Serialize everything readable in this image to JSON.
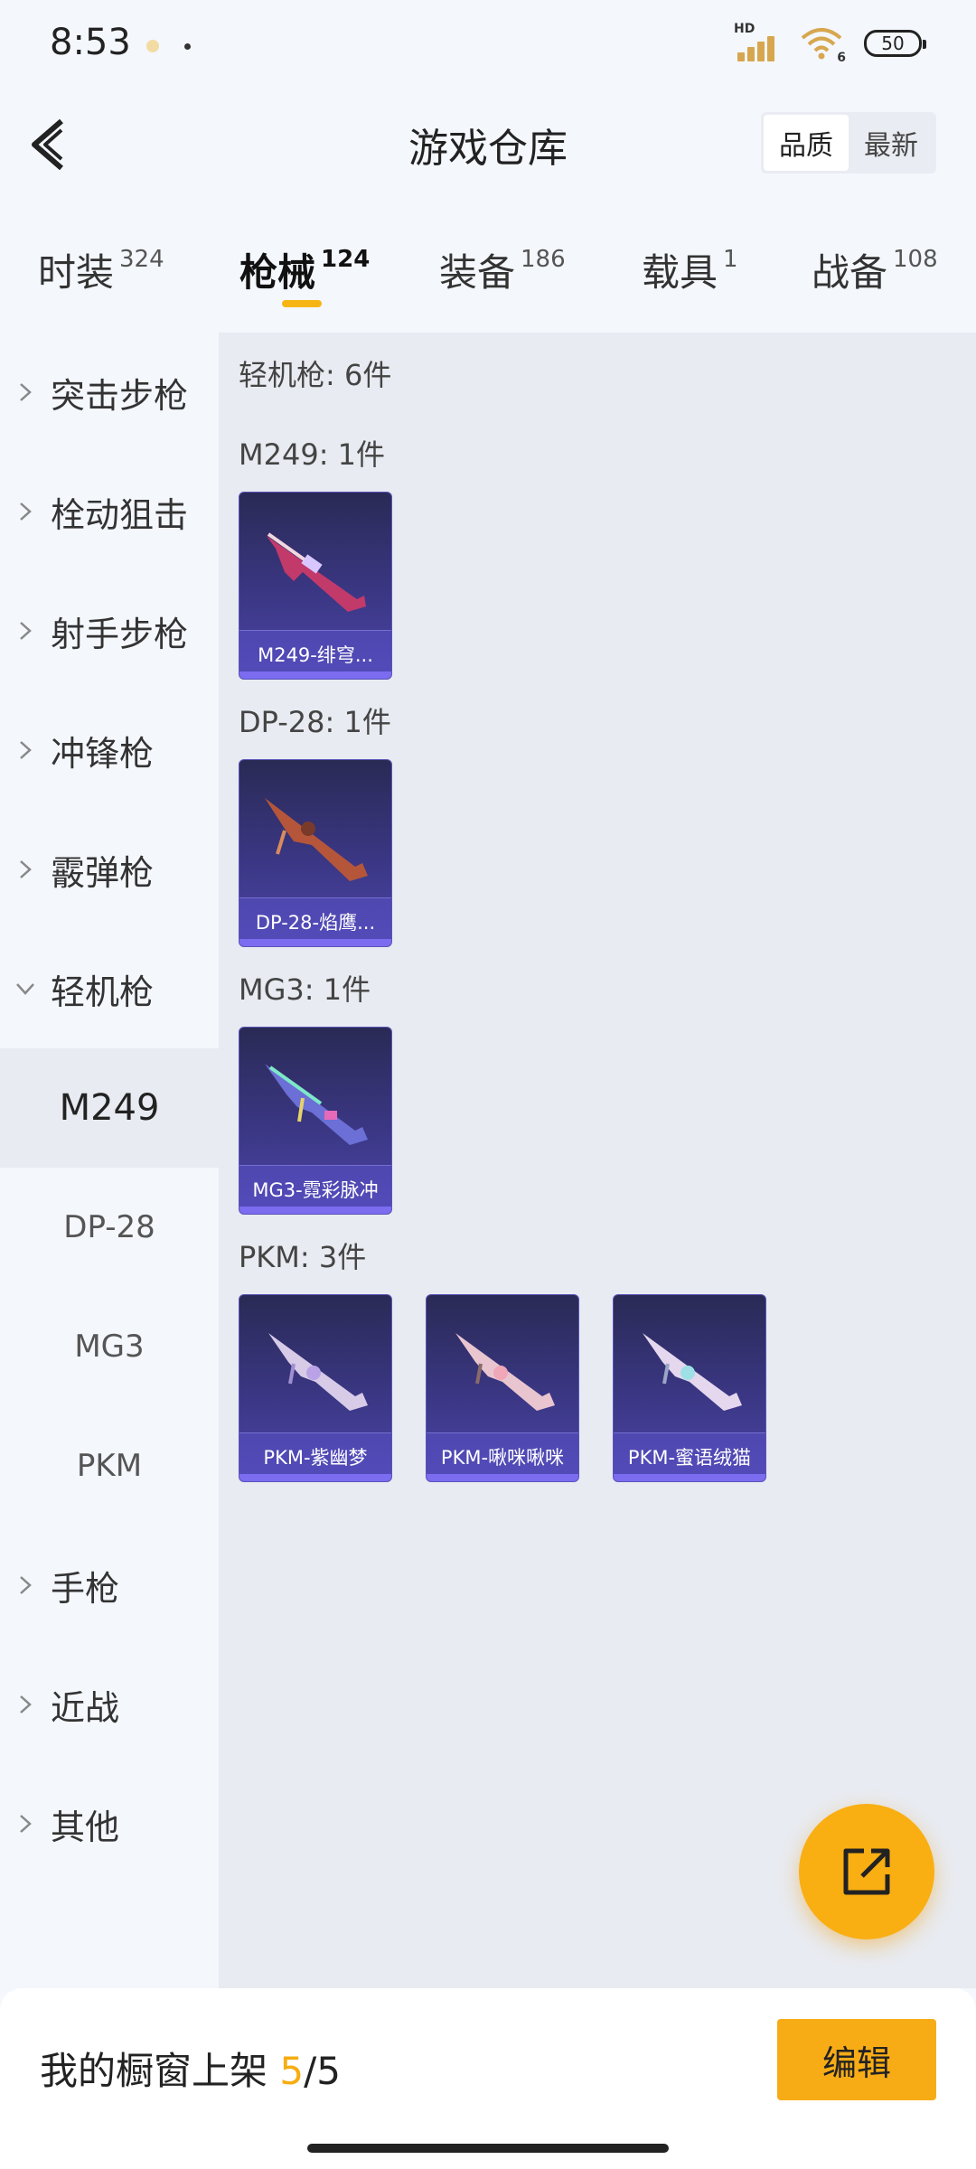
{
  "status_bar": {
    "time": "8:53",
    "battery": "50",
    "network_badge": "HD",
    "wifi_badge": "6"
  },
  "header": {
    "title": "游戏仓库",
    "sort_options": [
      "品质",
      "最新"
    ],
    "sort_selected": "品质"
  },
  "tabs": [
    {
      "label": "时装",
      "count": "324"
    },
    {
      "label": "枪械",
      "count": "124",
      "active": true
    },
    {
      "label": "装备",
      "count": "186"
    },
    {
      "label": "载具",
      "count": "1"
    },
    {
      "label": "战备",
      "count": "108"
    }
  ],
  "sidebar": {
    "categories": [
      "突击步枪",
      "栓动狙击",
      "射手步枪",
      "冲锋枪",
      "霰弹枪",
      "轻机枪",
      "手枪",
      "近战",
      "其他"
    ],
    "expanded": "轻机枪",
    "subitems": [
      "M249",
      "DP-28",
      "MG3",
      "PKM"
    ],
    "selected_sub": "M249"
  },
  "content": {
    "category_heading": "轻机枪: 6件",
    "groups": [
      {
        "heading": "M249: 1件",
        "items": [
          "M249-绯穹..."
        ]
      },
      {
        "heading": "DP-28: 1件",
        "items": [
          "DP-28-焰鹰..."
        ]
      },
      {
        "heading": "MG3: 1件",
        "items": [
          "MG3-霓彩脉冲"
        ]
      },
      {
        "heading": "PKM: 3件",
        "items": [
          "PKM-紫幽梦",
          "PKM-啾咪啾咪",
          "PKM-蜜语绒猫"
        ]
      }
    ]
  },
  "fab": {
    "icon": "share-icon"
  },
  "bottom": {
    "shelf_label": "我的橱窗上架",
    "shelf_current": "5",
    "shelf_total": "/5",
    "edit_label": "编辑"
  },
  "colors": {
    "accent": "#f7ac16",
    "card_bg": "#3b3785",
    "panel_bg": "#e8ebf1"
  }
}
